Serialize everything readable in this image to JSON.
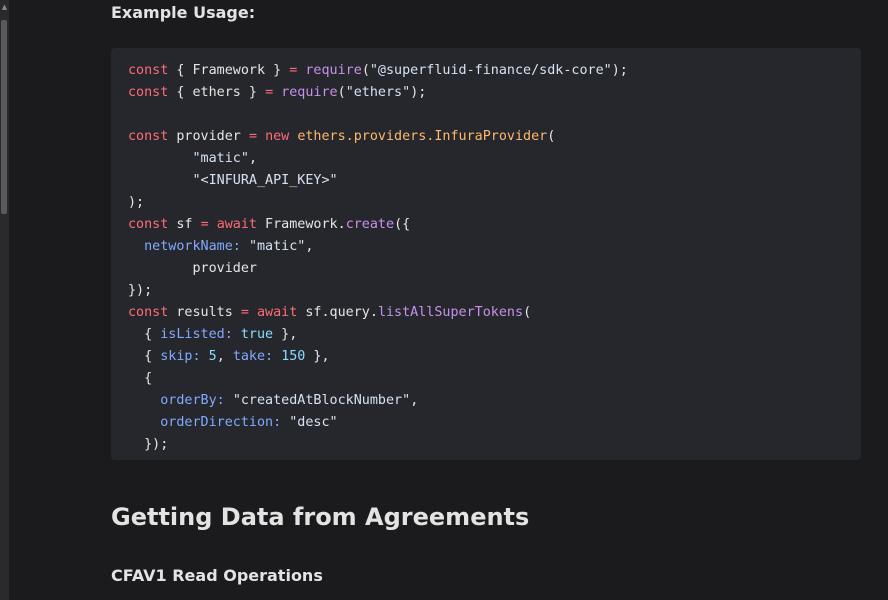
{
  "example_label": "Example Usage:",
  "code_lines": [
    [
      {
        "t": "kw",
        "v": "const"
      },
      {
        "t": "plain",
        "v": " { Framework } "
      },
      {
        "t": "kw",
        "v": "="
      },
      {
        "t": "plain",
        "v": " "
      },
      {
        "t": "fn",
        "v": "require"
      },
      {
        "t": "plain",
        "v": "("
      },
      {
        "t": "str",
        "v": "\"@superfluid-finance/sdk-core\""
      },
      {
        "t": "plain",
        "v": ");"
      }
    ],
    [
      {
        "t": "kw",
        "v": "const"
      },
      {
        "t": "plain",
        "v": " { ethers } "
      },
      {
        "t": "kw",
        "v": "="
      },
      {
        "t": "plain",
        "v": " "
      },
      {
        "t": "fn",
        "v": "require"
      },
      {
        "t": "plain",
        "v": "("
      },
      {
        "t": "str",
        "v": "\"ethers\""
      },
      {
        "t": "plain",
        "v": ");"
      }
    ],
    [],
    [
      {
        "t": "kw",
        "v": "const"
      },
      {
        "t": "plain",
        "v": " provider "
      },
      {
        "t": "kw",
        "v": "="
      },
      {
        "t": "plain",
        "v": " "
      },
      {
        "t": "kw",
        "v": "new"
      },
      {
        "t": "plain",
        "v": " "
      },
      {
        "t": "cls",
        "v": "ethers.providers.InfuraProvider"
      },
      {
        "t": "plain",
        "v": "("
      }
    ],
    [
      {
        "t": "plain",
        "v": "        "
      },
      {
        "t": "str",
        "v": "\"matic\""
      },
      {
        "t": "plain",
        "v": ","
      }
    ],
    [
      {
        "t": "plain",
        "v": "        "
      },
      {
        "t": "str",
        "v": "\"<INFURA_API_KEY>\""
      }
    ],
    [
      {
        "t": "plain",
        "v": ");"
      }
    ],
    [
      {
        "t": "kw",
        "v": "const"
      },
      {
        "t": "plain",
        "v": " sf "
      },
      {
        "t": "kw",
        "v": "="
      },
      {
        "t": "plain",
        "v": " "
      },
      {
        "t": "kw",
        "v": "await"
      },
      {
        "t": "plain",
        "v": " Framework."
      },
      {
        "t": "fn",
        "v": "create"
      },
      {
        "t": "plain",
        "v": "({"
      }
    ],
    [
      {
        "t": "plain",
        "v": "  "
      },
      {
        "t": "prop",
        "v": "networkName:"
      },
      {
        "t": "plain",
        "v": " "
      },
      {
        "t": "str",
        "v": "\"matic\""
      },
      {
        "t": "plain",
        "v": ","
      }
    ],
    [
      {
        "t": "plain",
        "v": "        provider"
      }
    ],
    [
      {
        "t": "plain",
        "v": "});"
      }
    ],
    [
      {
        "t": "kw",
        "v": "const"
      },
      {
        "t": "plain",
        "v": " results "
      },
      {
        "t": "kw",
        "v": "="
      },
      {
        "t": "plain",
        "v": " "
      },
      {
        "t": "kw",
        "v": "await"
      },
      {
        "t": "plain",
        "v": " sf.query."
      },
      {
        "t": "fn",
        "v": "listAllSuperTokens"
      },
      {
        "t": "plain",
        "v": "("
      }
    ],
    [
      {
        "t": "plain",
        "v": "  { "
      },
      {
        "t": "prop",
        "v": "isListed:"
      },
      {
        "t": "plain",
        "v": " "
      },
      {
        "t": "bool",
        "v": "true"
      },
      {
        "t": "plain",
        "v": " },"
      }
    ],
    [
      {
        "t": "plain",
        "v": "  { "
      },
      {
        "t": "prop",
        "v": "skip:"
      },
      {
        "t": "plain",
        "v": " "
      },
      {
        "t": "num",
        "v": "5"
      },
      {
        "t": "plain",
        "v": ", "
      },
      {
        "t": "prop",
        "v": "take:"
      },
      {
        "t": "plain",
        "v": " "
      },
      {
        "t": "num",
        "v": "150"
      },
      {
        "t": "plain",
        "v": " },"
      }
    ],
    [
      {
        "t": "plain",
        "v": "  {"
      }
    ],
    [
      {
        "t": "plain",
        "v": "    "
      },
      {
        "t": "prop",
        "v": "orderBy:"
      },
      {
        "t": "plain",
        "v": " "
      },
      {
        "t": "str",
        "v": "\"createdAtBlockNumber\""
      },
      {
        "t": "plain",
        "v": ","
      }
    ],
    [
      {
        "t": "plain",
        "v": "    "
      },
      {
        "t": "prop",
        "v": "orderDirection:"
      },
      {
        "t": "plain",
        "v": " "
      },
      {
        "t": "str",
        "v": "\"desc\""
      }
    ],
    [
      {
        "t": "plain",
        "v": "  });"
      }
    ]
  ],
  "section_heading": "Getting Data from Agreements",
  "sub_heading": "CFAV1 Read Operations",
  "icons": {
    "scroll_up": "scroll-up-arrow-icon"
  },
  "colors": {
    "background": "#1b1b1d",
    "code_background": "#25272c",
    "keyword": "#ff6b7a",
    "function": "#c792ea",
    "class": "#ffb86c",
    "property": "#82aaff",
    "number": "#89ddff",
    "text": "#e3e3e3"
  }
}
